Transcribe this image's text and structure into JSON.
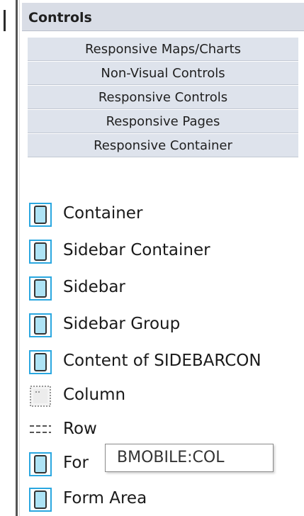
{
  "panel": {
    "title": "Controls"
  },
  "categories": [
    {
      "label": "Responsive Maps/Charts"
    },
    {
      "label": "Non-Visual Controls"
    },
    {
      "label": "Responsive Controls"
    },
    {
      "label": "Responsive Pages"
    },
    {
      "label": "Responsive Container"
    }
  ],
  "items": [
    {
      "label": "Container",
      "icon": "device-icon"
    },
    {
      "label": "Sidebar Container",
      "icon": "device-icon"
    },
    {
      "label": "Sidebar",
      "icon": "device-icon"
    },
    {
      "label": "Sidebar Group",
      "icon": "device-icon"
    },
    {
      "label": "Content of SIDEBARCON",
      "icon": "device-icon"
    },
    {
      "label": "Column",
      "icon": "column-icon"
    },
    {
      "label": "Row",
      "icon": "row-icon"
    },
    {
      "label": "For",
      "icon": "device-icon"
    },
    {
      "label": "Form Area",
      "icon": "device-icon"
    }
  ],
  "tooltip": {
    "text": "BMOBILE:COL"
  },
  "colors": {
    "header_bg": "#d9dde6",
    "category_bg": "#dee3ec",
    "icon_blue": "#2aa7e0",
    "icon_dark": "#333333"
  }
}
